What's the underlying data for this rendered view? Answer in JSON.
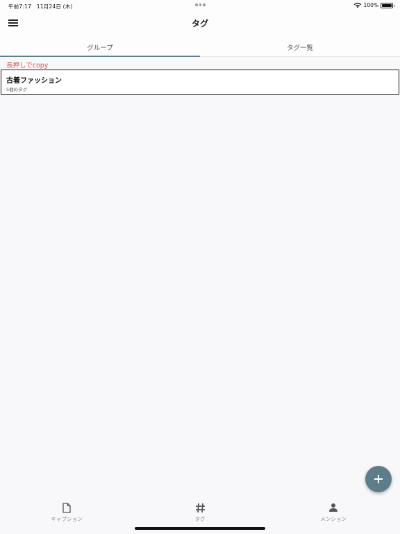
{
  "status_bar": {
    "time_date": "午前7:17　11月24日 (木)",
    "battery": "100%"
  },
  "header": {
    "title": "タグ"
  },
  "tabs": [
    {
      "label": "グループ",
      "active": true
    },
    {
      "label": "タグ一覧",
      "active": false
    }
  ],
  "hint": "長押しでcopy",
  "groups": [
    {
      "name": "古着ファッション",
      "count": "5個のタグ"
    }
  ],
  "bottom_nav": [
    {
      "label": "キャプション",
      "icon": "document-icon"
    },
    {
      "label": "タグ",
      "icon": "hash-icon"
    },
    {
      "label": "メンション",
      "icon": "person-icon"
    }
  ],
  "colors": {
    "accent": "#5e7d8a",
    "hint": "#e0524d",
    "background": "#f8f8fa"
  }
}
